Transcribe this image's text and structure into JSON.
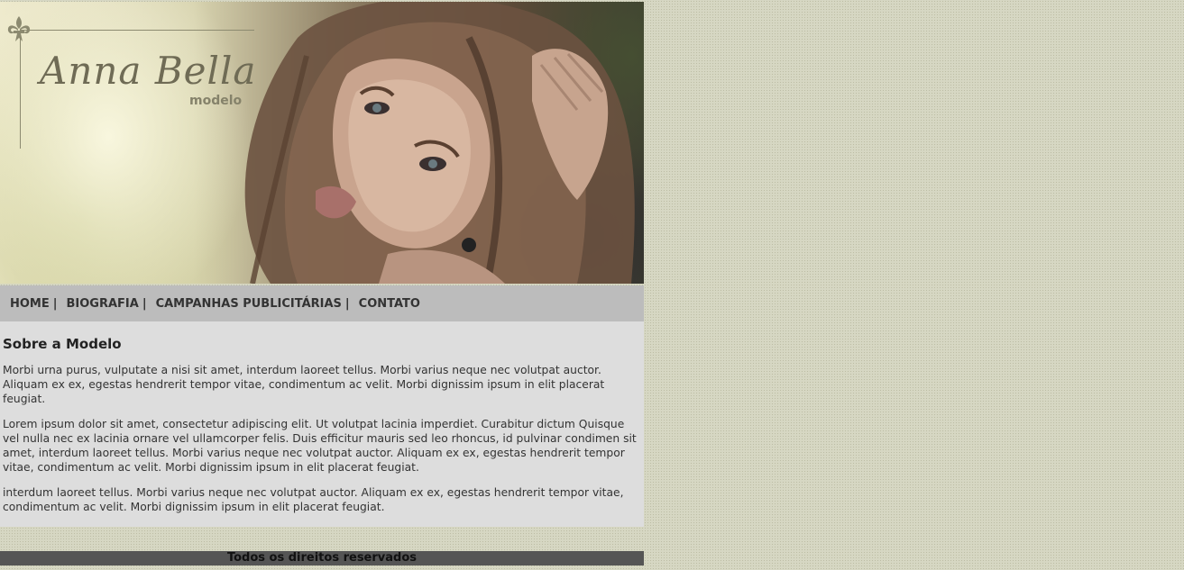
{
  "header": {
    "brand_name": "Anna Bella",
    "brand_sub": "modelo",
    "photo_icon": "model-portrait-photo",
    "logo_icon": "fleur-de-lis-icon"
  },
  "nav": {
    "items": [
      {
        "label": "HOME"
      },
      {
        "label": "BIOGRAFIA"
      },
      {
        "label": "CAMPANHAS PUBLICITÁRIAS"
      },
      {
        "label": "CONTATO"
      }
    ],
    "separator": "|"
  },
  "main": {
    "title": "Sobre a Modelo",
    "paragraphs": [
      "Morbi urna purus, vulputate a nisi sit amet, interdum laoreet tellus. Morbi varius neque nec volutpat auctor. Aliquam ex ex, egestas hendrerit tempor vitae, condimentum ac velit. Morbi dignissim ipsum in elit placerat feugiat.",
      "Lorem ipsum dolor sit amet, consectetur adipiscing elit. Ut volutpat lacinia imperdiet. Curabitur dictum Quisque vel nulla nec ex lacinia ornare vel ullamcorper felis. Duis efficitur mauris sed leo rhoncus, id pulvinar condimen sit amet, interdum laoreet tellus. Morbi varius neque nec volutpat auctor. Aliquam ex ex, egestas hendrerit tempor vitae, condimentum ac velit. Morbi dignissim ipsum in elit placerat feugiat.",
      "interdum laoreet tellus. Morbi varius neque nec volutpat auctor. Aliquam ex ex, egestas hendrerit tempor vitae, condimentum ac velit. Morbi dignissim ipsum in elit placerat feugiat."
    ]
  },
  "footer": {
    "text": "Todos os direitos reservados"
  },
  "colors": {
    "page_bg": "#d6d7c3",
    "nav_bg": "#bcbcbc",
    "content_bg": "#dddddd",
    "footer_bg": "#555555"
  }
}
